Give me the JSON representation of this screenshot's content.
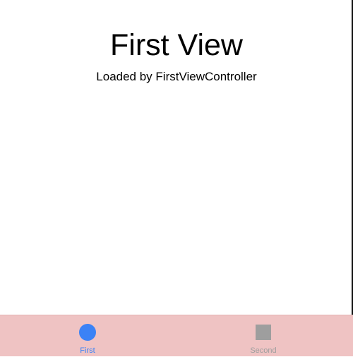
{
  "main": {
    "title": "First View",
    "subtitle": "Loaded by FirstViewController"
  },
  "tabbar": {
    "background_color": "#efc3c3",
    "tabs": [
      {
        "label": "First",
        "icon": "circle-icon",
        "selected": true,
        "color": "#3b82f6"
      },
      {
        "label": "Second",
        "icon": "square-icon",
        "selected": false,
        "color": "#9e9e9e"
      }
    ]
  }
}
